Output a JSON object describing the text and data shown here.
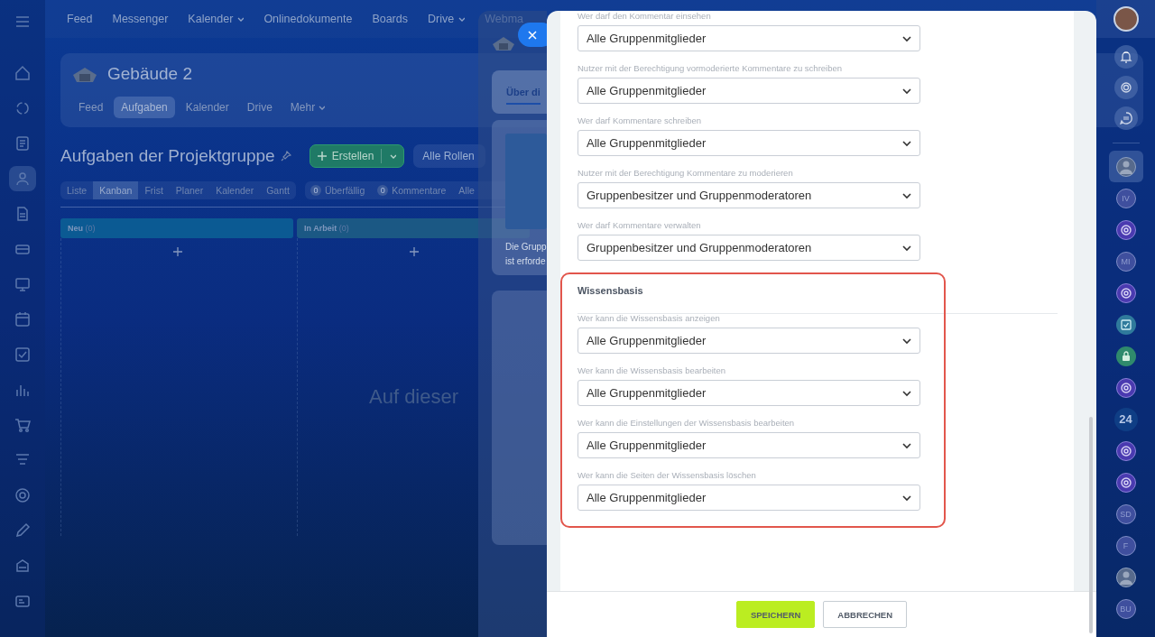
{
  "top_nav": [
    {
      "label": "Feed",
      "dropdown": false
    },
    {
      "label": "Messenger",
      "dropdown": false
    },
    {
      "label": "Kalender",
      "dropdown": true
    },
    {
      "label": "Onlinedokumente",
      "dropdown": false
    },
    {
      "label": "Boards",
      "dropdown": false
    },
    {
      "label": "Drive",
      "dropdown": true
    },
    {
      "label": "Webma",
      "dropdown": false
    }
  ],
  "group": {
    "name": "Gebäude 2",
    "tabs": [
      {
        "label": "Feed",
        "selected": false,
        "dropdown": false
      },
      {
        "label": "Aufgaben",
        "selected": true,
        "dropdown": false
      },
      {
        "label": "Kalender",
        "selected": false,
        "dropdown": false
      },
      {
        "label": "Drive",
        "selected": false,
        "dropdown": false
      },
      {
        "label": "Mehr",
        "selected": false,
        "dropdown": true
      }
    ]
  },
  "page_title": "Aufgaben der Projektgruppe",
  "create_button": "Erstellen",
  "roles_filter": "Alle Rollen",
  "views": [
    {
      "label": "Liste",
      "selected": false
    },
    {
      "label": "Kanban",
      "selected": true
    },
    {
      "label": "Frist",
      "selected": false
    },
    {
      "label": "Planer",
      "selected": false
    },
    {
      "label": "Kalender",
      "selected": false
    },
    {
      "label": "Gantt",
      "selected": false
    }
  ],
  "counters": [
    {
      "count": "0",
      "label": "Überfällig"
    },
    {
      "count": "0",
      "label": "Kommentare"
    }
  ],
  "counters_more": "Alle",
  "columns": [
    {
      "title": "Neu",
      "count": "(0)",
      "color": "#0b5a93"
    },
    {
      "title": "In Arbeit",
      "count": "(0)",
      "color": "#1b5884"
    }
  ],
  "empty_text": "Auf dieser",
  "side_panel": {
    "tab": "Über di",
    "text": "Die Grupp\nist erforde"
  },
  "settings": {
    "sections": [
      {
        "highlighted": false,
        "fields": [
          {
            "label": "Wer darf den Kommentar einsehen",
            "value": "Alle Gruppenmitglieder"
          },
          {
            "label": "Nutzer mit der Berechtigung vormoderierte Kommentare zu schreiben",
            "value": "Alle Gruppenmitglieder"
          },
          {
            "label": "Wer darf Kommentare schreiben",
            "value": "Alle Gruppenmitglieder"
          },
          {
            "label": "Nutzer mit der Berechtigung Kommentare zu moderieren",
            "value": "Gruppenbesitzer und Gruppenmoderatoren"
          },
          {
            "label": "Wer darf Kommentare verwalten",
            "value": "Gruppenbesitzer und Gruppenmoderatoren"
          }
        ]
      },
      {
        "title": "Wissensbasis",
        "highlighted": true,
        "fields": [
          {
            "label": "Wer kann die Wissensbasis anzeigen",
            "value": "Alle Gruppenmitglieder"
          },
          {
            "label": "Wer kann die Wissensbasis bearbeiten",
            "value": "Alle Gruppenmitglieder"
          },
          {
            "label": "Wer kann die Einstellungen der Wissensbasis bearbeiten",
            "value": "Alle Gruppenmitglieder"
          },
          {
            "label": "Wer kann die Seiten der Wissensbasis löschen",
            "value": "Alle Gruppenmitglieder"
          }
        ]
      }
    ]
  },
  "footer": {
    "buttons": [
      {
        "label": "SPEICHERN",
        "kind": "primary"
      },
      {
        "label": "ABBRECHEN",
        "kind": "secondary"
      }
    ]
  },
  "right_rail": {
    "tools": [
      {
        "kind": "bell"
      },
      {
        "kind": "swirl"
      },
      {
        "kind": "chat"
      }
    ],
    "items": [
      {
        "kind": "photo",
        "selected": true
      },
      {
        "kind": "initials",
        "text": "IV",
        "selected": false
      },
      {
        "kind": "logo",
        "selected": false
      },
      {
        "kind": "initials",
        "text": "MI",
        "selected": false
      },
      {
        "kind": "logo",
        "selected": false
      },
      {
        "kind": "tasks",
        "selected": false
      },
      {
        "kind": "lock",
        "selected": false
      },
      {
        "kind": "logo",
        "selected": false
      },
      {
        "kind": "number",
        "text": "24",
        "selected": false
      },
      {
        "kind": "logo",
        "selected": false
      },
      {
        "kind": "logo",
        "selected": false
      },
      {
        "kind": "initials",
        "text": "SD",
        "selected": false
      },
      {
        "kind": "initials",
        "text": "F",
        "selected": false
      },
      {
        "kind": "photo",
        "selected": false
      },
      {
        "kind": "initials",
        "text": "BU",
        "selected": false
      }
    ]
  }
}
